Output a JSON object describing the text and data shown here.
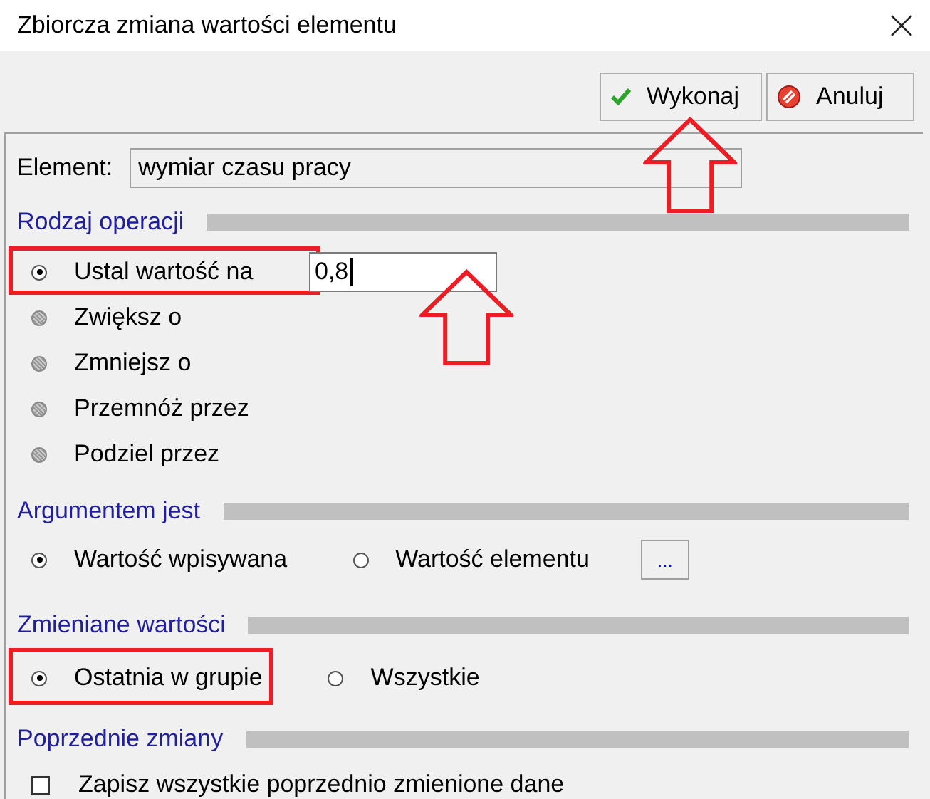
{
  "window": {
    "title": "Zbiorcza zmiana wartości elementu"
  },
  "buttons": [
    {
      "label": "Wykonaj",
      "kind": "ok",
      "arrow": true
    },
    {
      "label": "Anuluj",
      "kind": "cancel",
      "arrow": false
    }
  ],
  "element": {
    "label": "Element:",
    "value": "wymiar czasu pracy"
  },
  "sections": [
    {
      "title": "Rodzaj operacji",
      "kind": "radio-list",
      "field": {
        "value": "0,8",
        "arrow": true
      },
      "options": [
        {
          "label": "Ustal wartość na",
          "selected": true,
          "shaded": false,
          "highlighted": true
        },
        {
          "label": "Zwiększ o",
          "selected": false,
          "shaded": true,
          "highlighted": false
        },
        {
          "label": "Zmniejsz o",
          "selected": false,
          "shaded": true,
          "highlighted": false
        },
        {
          "label": "Przemnóż przez",
          "selected": false,
          "shaded": true,
          "highlighted": false
        },
        {
          "label": "Podziel przez",
          "selected": false,
          "shaded": true,
          "highlighted": false
        }
      ]
    },
    {
      "title": "Argumentem jest",
      "kind": "radio-row",
      "browse_button": "...",
      "options": [
        {
          "label": "Wartość wpisywana",
          "selected": true,
          "highlighted": false
        },
        {
          "label": "Wartość elementu",
          "selected": false,
          "highlighted": false
        }
      ]
    },
    {
      "title": "Zmieniane wartości",
      "kind": "radio-row",
      "options": [
        {
          "label": "Ostatnia w grupie",
          "selected": true,
          "highlighted": true
        },
        {
          "label": "Wszystkie",
          "selected": false,
          "highlighted": false
        }
      ]
    },
    {
      "title": "Poprzednie zmiany",
      "kind": "checkbox",
      "items": [
        {
          "label": "Zapisz wszystkie poprzednio zmienione dane",
          "checked": false
        }
      ]
    }
  ]
}
